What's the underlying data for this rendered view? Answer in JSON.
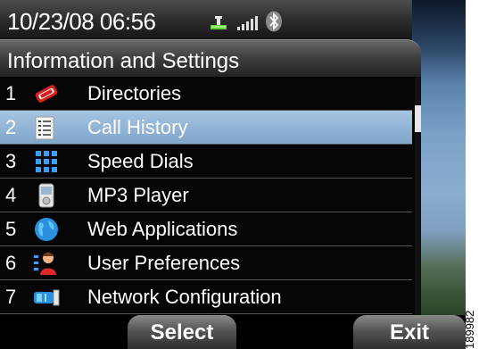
{
  "status": {
    "datetime": "10/23/08 06:56",
    "icons": [
      "phone-in-use-icon",
      "signal-strength-icon",
      "bluetooth-icon"
    ]
  },
  "title": "Information and Settings",
  "menu": {
    "selected_index": 2,
    "items": [
      {
        "number": "1",
        "label": "Directories",
        "icon": "directories-icon"
      },
      {
        "number": "2",
        "label": "Call History",
        "icon": "call-history-icon"
      },
      {
        "number": "3",
        "label": "Speed Dials",
        "icon": "speed-dials-icon"
      },
      {
        "number": "4",
        "label": "MP3 Player",
        "icon": "mp3-player-icon"
      },
      {
        "number": "5",
        "label": "Web Applications",
        "icon": "web-applications-icon"
      },
      {
        "number": "6",
        "label": "User Preferences",
        "icon": "user-preferences-icon"
      },
      {
        "number": "7",
        "label": "Network Configuration",
        "icon": "network-configuration-icon"
      }
    ]
  },
  "softkeys": {
    "select": "Select",
    "exit": "Exit"
  },
  "figure_id": "189982",
  "colors": {
    "selection": "#8fb3d6",
    "background": "#000000",
    "text": "#ffffff"
  }
}
